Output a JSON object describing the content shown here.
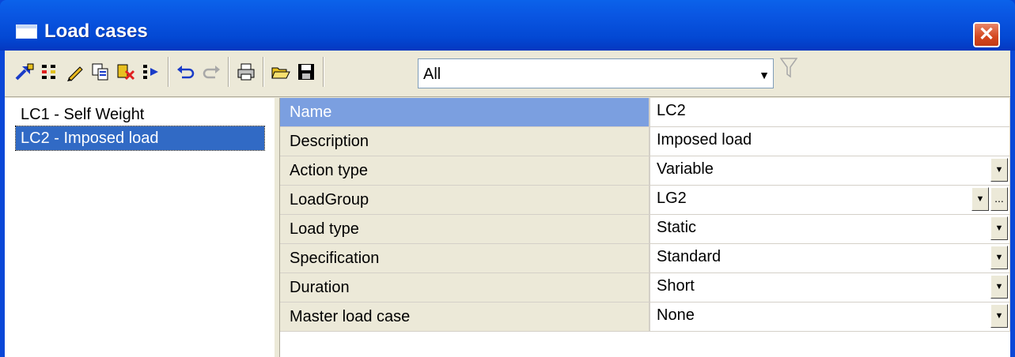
{
  "window": {
    "title": "Load cases"
  },
  "toolbar": {
    "buttons": [
      {
        "icon": "new-load-case-icon"
      },
      {
        "icon": "insert-icon"
      },
      {
        "icon": "edit-icon"
      },
      {
        "icon": "copy-icon"
      },
      {
        "icon": "delete-icon"
      },
      {
        "icon": "move-icon"
      },
      {
        "icon": "undo-icon"
      },
      {
        "icon": "redo-icon"
      },
      {
        "icon": "print-icon"
      },
      {
        "icon": "open-icon"
      },
      {
        "icon": "save-icon"
      }
    ],
    "filter": {
      "value": "All"
    }
  },
  "load_cases": [
    {
      "label": "LC1 - Self Weight",
      "selected": false
    },
    {
      "label": "LC2 - Imposed load",
      "selected": true
    }
  ],
  "properties": [
    {
      "name": "Name",
      "value": "LC2",
      "control": "text"
    },
    {
      "name": "Description",
      "value": "Imposed load",
      "control": "text"
    },
    {
      "name": "Action type",
      "value": "Variable",
      "control": "dropdown"
    },
    {
      "name": "LoadGroup",
      "value": "LG2",
      "control": "dropdown-ellipsis"
    },
    {
      "name": "Load type",
      "value": "Static",
      "control": "dropdown"
    },
    {
      "name": "Specification",
      "value": "Standard",
      "control": "dropdown"
    },
    {
      "name": "Duration",
      "value": "Short",
      "control": "dropdown"
    },
    {
      "name": "Master load case",
      "value": "None",
      "control": "dropdown"
    }
  ]
}
